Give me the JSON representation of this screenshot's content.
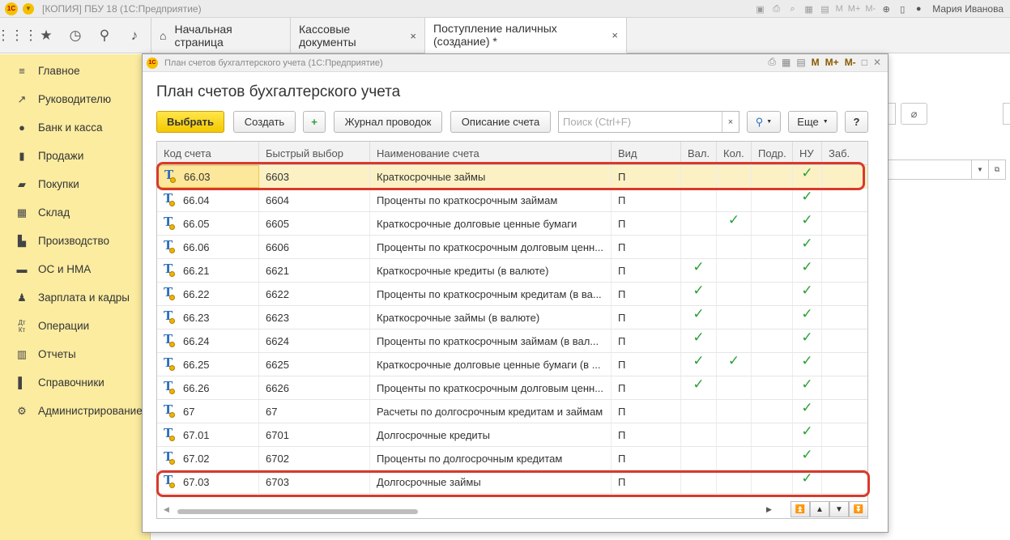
{
  "app": {
    "title": "[КОПИЯ] ПБУ 18  (1С:Предприятие)",
    "logo_text": "1С",
    "user": "Мария Иванова",
    "m_labels": [
      "M",
      "M+",
      "M-"
    ]
  },
  "tabs": [
    {
      "label": "Начальная страница",
      "closable": false
    },
    {
      "label": "Кассовые документы",
      "closable": true
    },
    {
      "label": "Поступление наличных (создание) *",
      "closable": true
    }
  ],
  "tab_close_glyph": "×",
  "sidebar": {
    "items": [
      {
        "label": "Главное",
        "icon": "menu-icon"
      },
      {
        "label": "Руководителю",
        "icon": "chart-line-icon"
      },
      {
        "label": "Банк и касса",
        "icon": "coin-icon"
      },
      {
        "label": "Продажи",
        "icon": "cart-icon"
      },
      {
        "label": "Покупки",
        "icon": "basket-icon"
      },
      {
        "label": "Склад",
        "icon": "warehouse-icon"
      },
      {
        "label": "Производство",
        "icon": "factory-icon"
      },
      {
        "label": "ОС и НМА",
        "icon": "truck-icon"
      },
      {
        "label": "Зарплата и кадры",
        "icon": "person-icon"
      },
      {
        "label": "Операции",
        "icon": "dt-kt-icon"
      },
      {
        "label": "Отчеты",
        "icon": "bar-chart-icon"
      },
      {
        "label": "Справочники",
        "icon": "book-icon"
      },
      {
        "label": "Администрирование",
        "icon": "gear-icon"
      }
    ]
  },
  "dialog": {
    "window_title": "План счетов бухгалтерского учета  (1С:Предприятие)",
    "heading": "План счетов бухгалтерского учета",
    "m_labels": [
      "M",
      "M+",
      "M-"
    ],
    "toolbar": {
      "select_label": "Выбрать",
      "create_label": "Создать",
      "journal_label": "Журнал проводок",
      "description_label": "Описание счета",
      "search_placeholder": "Поиск (Ctrl+F)",
      "clear_glyph": "×",
      "more_label": "Еще",
      "help_label": "?"
    },
    "columns": [
      "Код счета",
      "Быстрый выбор",
      "Наименование счета",
      "Вид",
      "Вал.",
      "Кол.",
      "Подр.",
      "НУ",
      "Заб."
    ],
    "rows": [
      {
        "code": "66.03",
        "quick": "6603",
        "name": "Краткосрочные займы",
        "kind": "П",
        "val": false,
        "kol": false,
        "podr": false,
        "nu": true,
        "selected": true,
        "highlighted": true
      },
      {
        "code": "66.04",
        "quick": "6604",
        "name": "Проценты по краткосрочным займам",
        "kind": "П",
        "val": false,
        "kol": false,
        "podr": false,
        "nu": true
      },
      {
        "code": "66.05",
        "quick": "6605",
        "name": "Краткосрочные долговые ценные бумаги",
        "kind": "П",
        "val": false,
        "kol": true,
        "podr": false,
        "nu": true
      },
      {
        "code": "66.06",
        "quick": "6606",
        "name": "Проценты по краткосрочным долговым ценн...",
        "kind": "П",
        "val": false,
        "kol": false,
        "podr": false,
        "nu": true
      },
      {
        "code": "66.21",
        "quick": "6621",
        "name": "Краткосрочные кредиты (в валюте)",
        "kind": "П",
        "val": true,
        "kol": false,
        "podr": false,
        "nu": true
      },
      {
        "code": "66.22",
        "quick": "6622",
        "name": "Проценты по краткосрочным кредитам (в ва...",
        "kind": "П",
        "val": true,
        "kol": false,
        "podr": false,
        "nu": true
      },
      {
        "code": "66.23",
        "quick": "6623",
        "name": "Краткосрочные займы (в валюте)",
        "kind": "П",
        "val": true,
        "kol": false,
        "podr": false,
        "nu": true
      },
      {
        "code": "66.24",
        "quick": "6624",
        "name": "Проценты по краткосрочным займам (в вал...",
        "kind": "П",
        "val": true,
        "kol": false,
        "podr": false,
        "nu": true
      },
      {
        "code": "66.25",
        "quick": "6625",
        "name": "Краткосрочные долговые ценные бумаги (в ...",
        "kind": "П",
        "val": true,
        "kol": true,
        "podr": false,
        "nu": true
      },
      {
        "code": "66.26",
        "quick": "6626",
        "name": "Проценты по краткосрочным долговым ценн...",
        "kind": "П",
        "val": true,
        "kol": false,
        "podr": false,
        "nu": true
      },
      {
        "code": "67",
        "quick": "67",
        "name": "Расчеты по долгосрочным кредитам и займам",
        "kind": "П",
        "val": false,
        "kol": false,
        "podr": false,
        "nu": true
      },
      {
        "code": "67.01",
        "quick": "6701",
        "name": "Долгосрочные кредиты",
        "kind": "П",
        "val": false,
        "kol": false,
        "podr": false,
        "nu": true
      },
      {
        "code": "67.02",
        "quick": "6702",
        "name": "Проценты по долгосрочным кредитам",
        "kind": "П",
        "val": false,
        "kol": false,
        "podr": false,
        "nu": true
      },
      {
        "code": "67.03",
        "quick": "6703",
        "name": "Долгосрочные займы",
        "kind": "П",
        "val": false,
        "kol": false,
        "podr": false,
        "nu": true,
        "highlighted": true
      }
    ],
    "check_glyph": "✓",
    "colors": {
      "accent_yellow": "#f4c800",
      "check_green": "#2aa035",
      "highlight_red": "#d93a2b",
      "sidebar_bg": "#fbeca0"
    }
  }
}
